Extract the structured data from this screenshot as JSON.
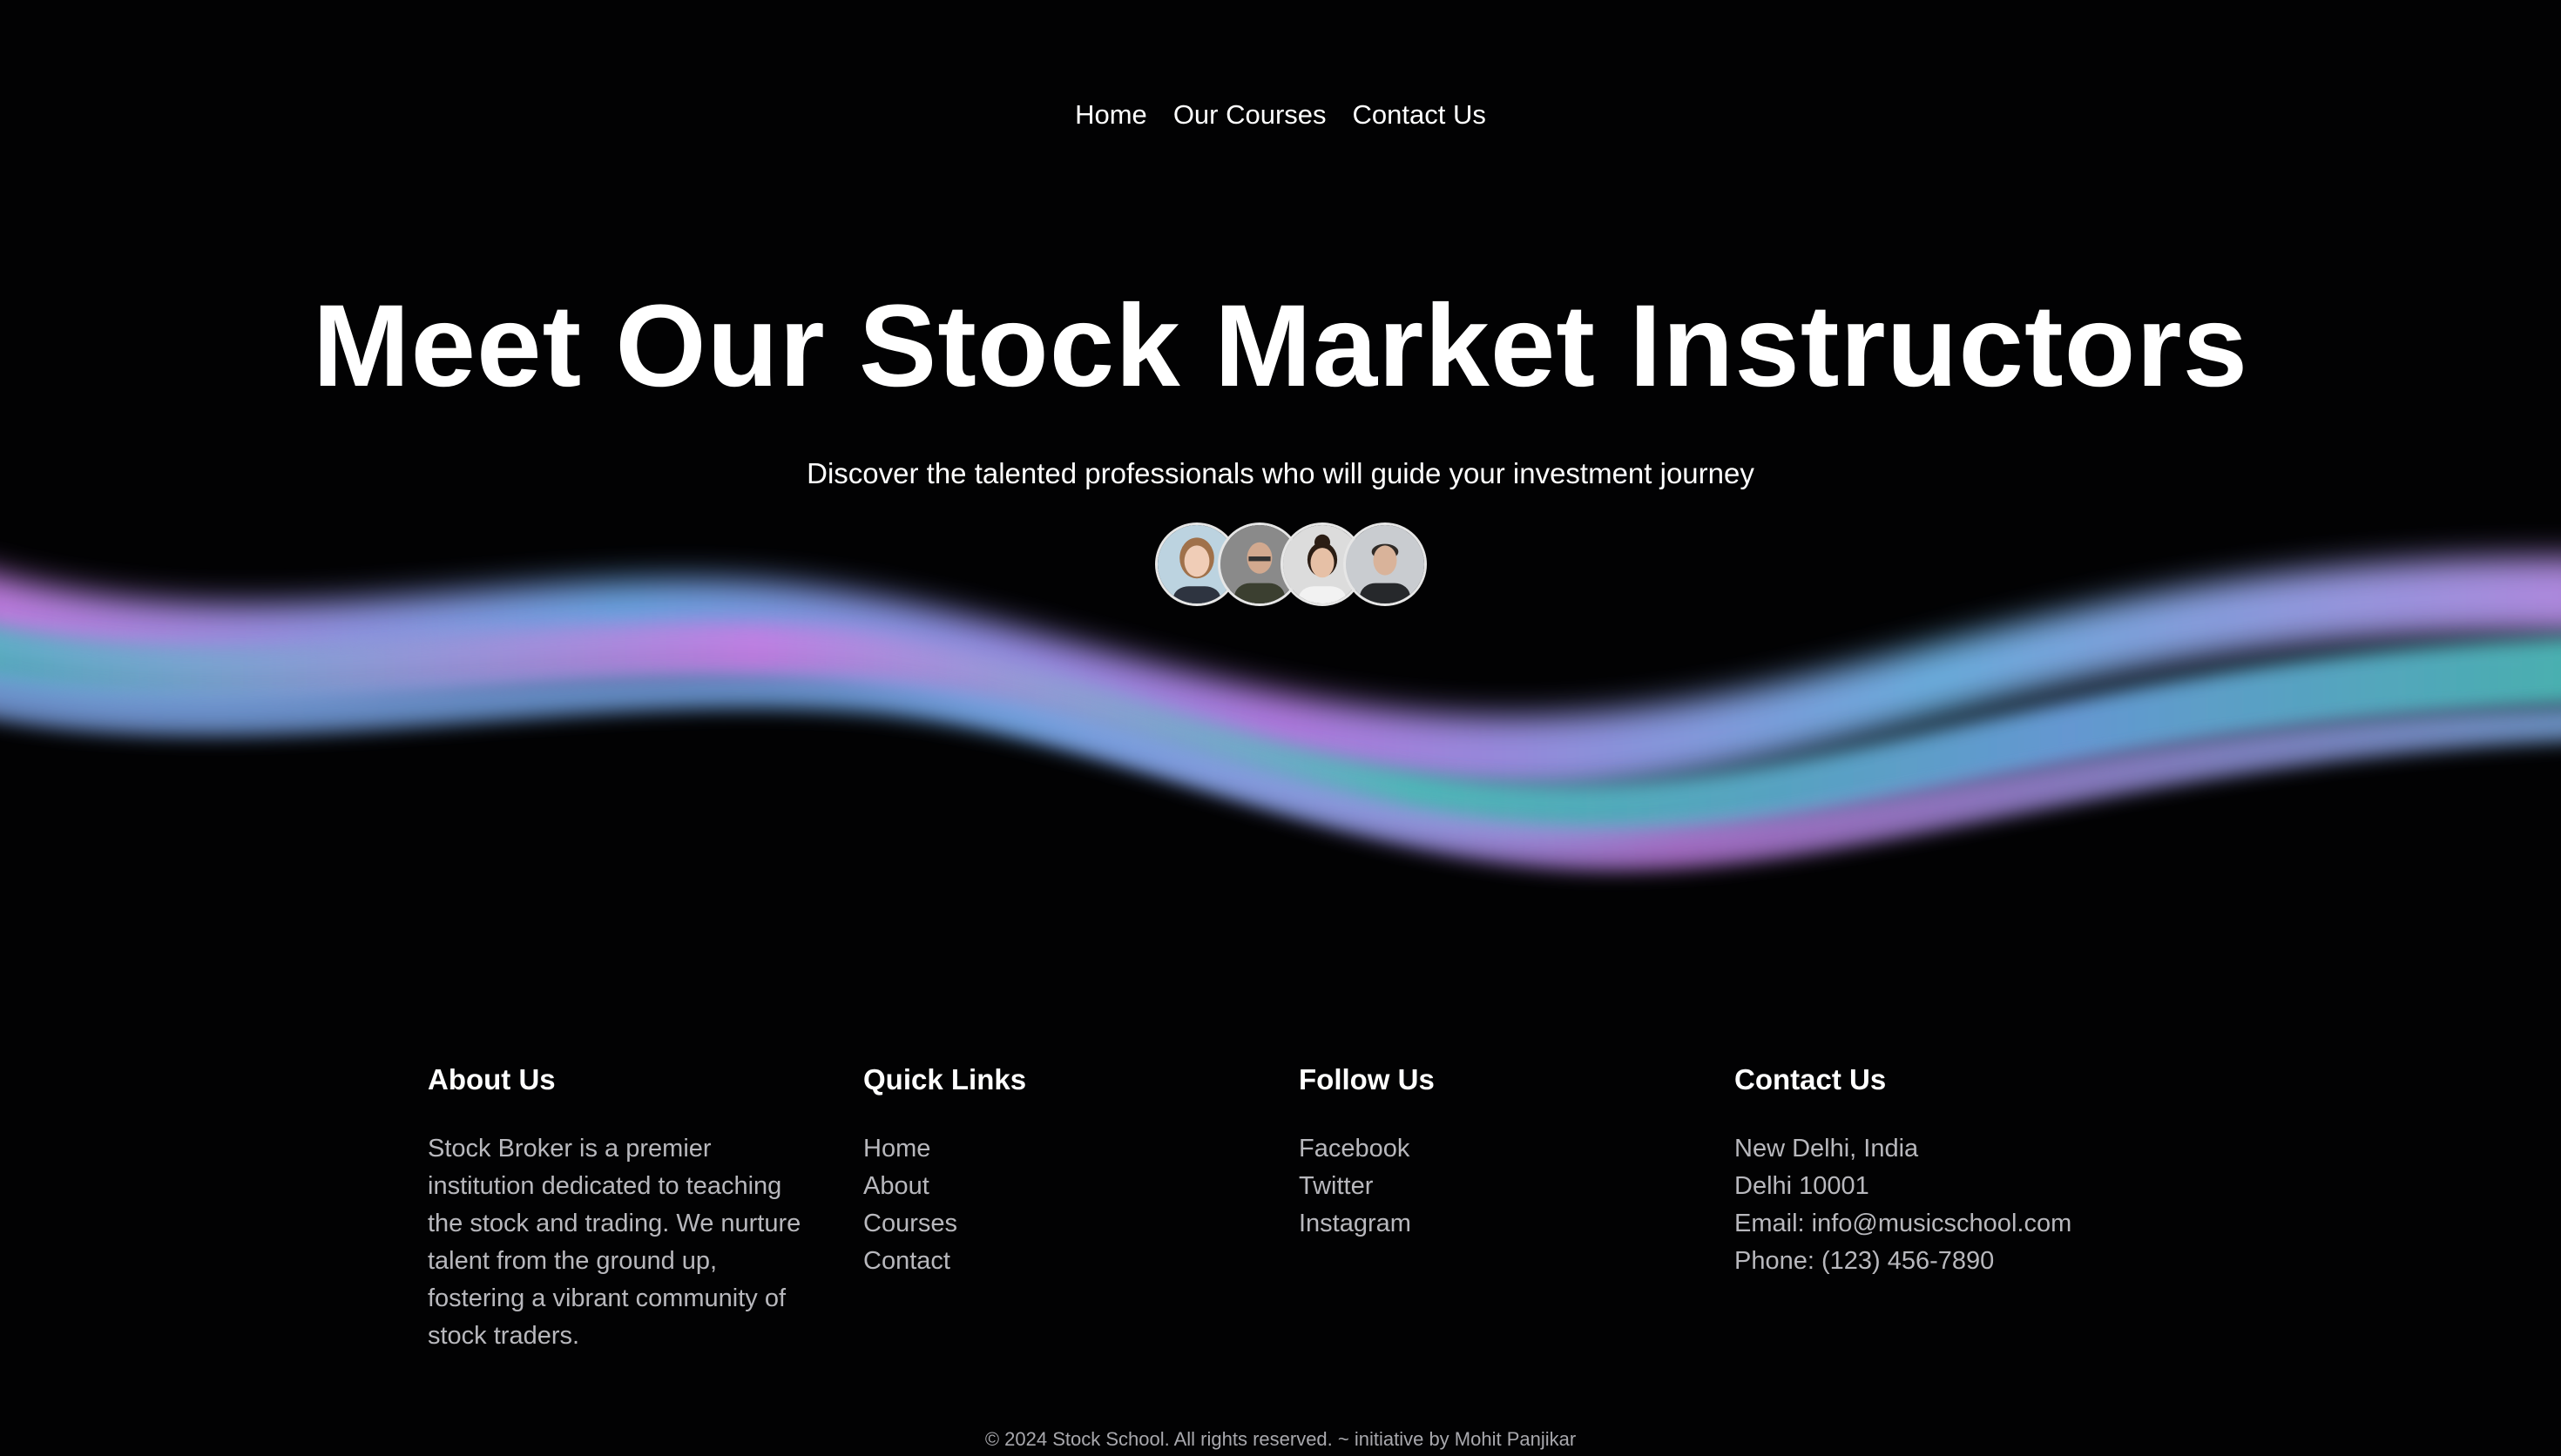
{
  "nav": {
    "items": [
      "Home",
      "Our Courses",
      "Contact Us"
    ]
  },
  "hero": {
    "title": "Meet Our Stock Market Instructors",
    "subtitle": "Discover the talented professionals who will guide your investment journey"
  },
  "footer": {
    "about": {
      "heading": "About Us",
      "text": "Stock Broker is a premier institution dedicated to teaching the stock and trading. We nurture talent from the ground up, fostering a vibrant community of stock traders."
    },
    "quick_links": {
      "heading": "Quick Links",
      "items": [
        "Home",
        "About",
        "Courses",
        "Contact"
      ]
    },
    "follow": {
      "heading": "Follow Us",
      "items": [
        "Facebook",
        "Twitter",
        "Instagram"
      ]
    },
    "contact": {
      "heading": "Contact Us",
      "lines": [
        "New Delhi, India",
        "Delhi 10001",
        "Email: info@musicschool.com",
        "Phone: (123) 456-7890"
      ]
    },
    "copyright": "© 2024 Stock School. All rights reserved. ~ initiative by Mohit Panjikar"
  },
  "colors": {
    "background": "#020203",
    "wave_pink": "#c77fe6",
    "wave_blue": "#6fa8e8",
    "wave_teal": "#4fc4c0",
    "muted_text": "#b8b8bd"
  }
}
